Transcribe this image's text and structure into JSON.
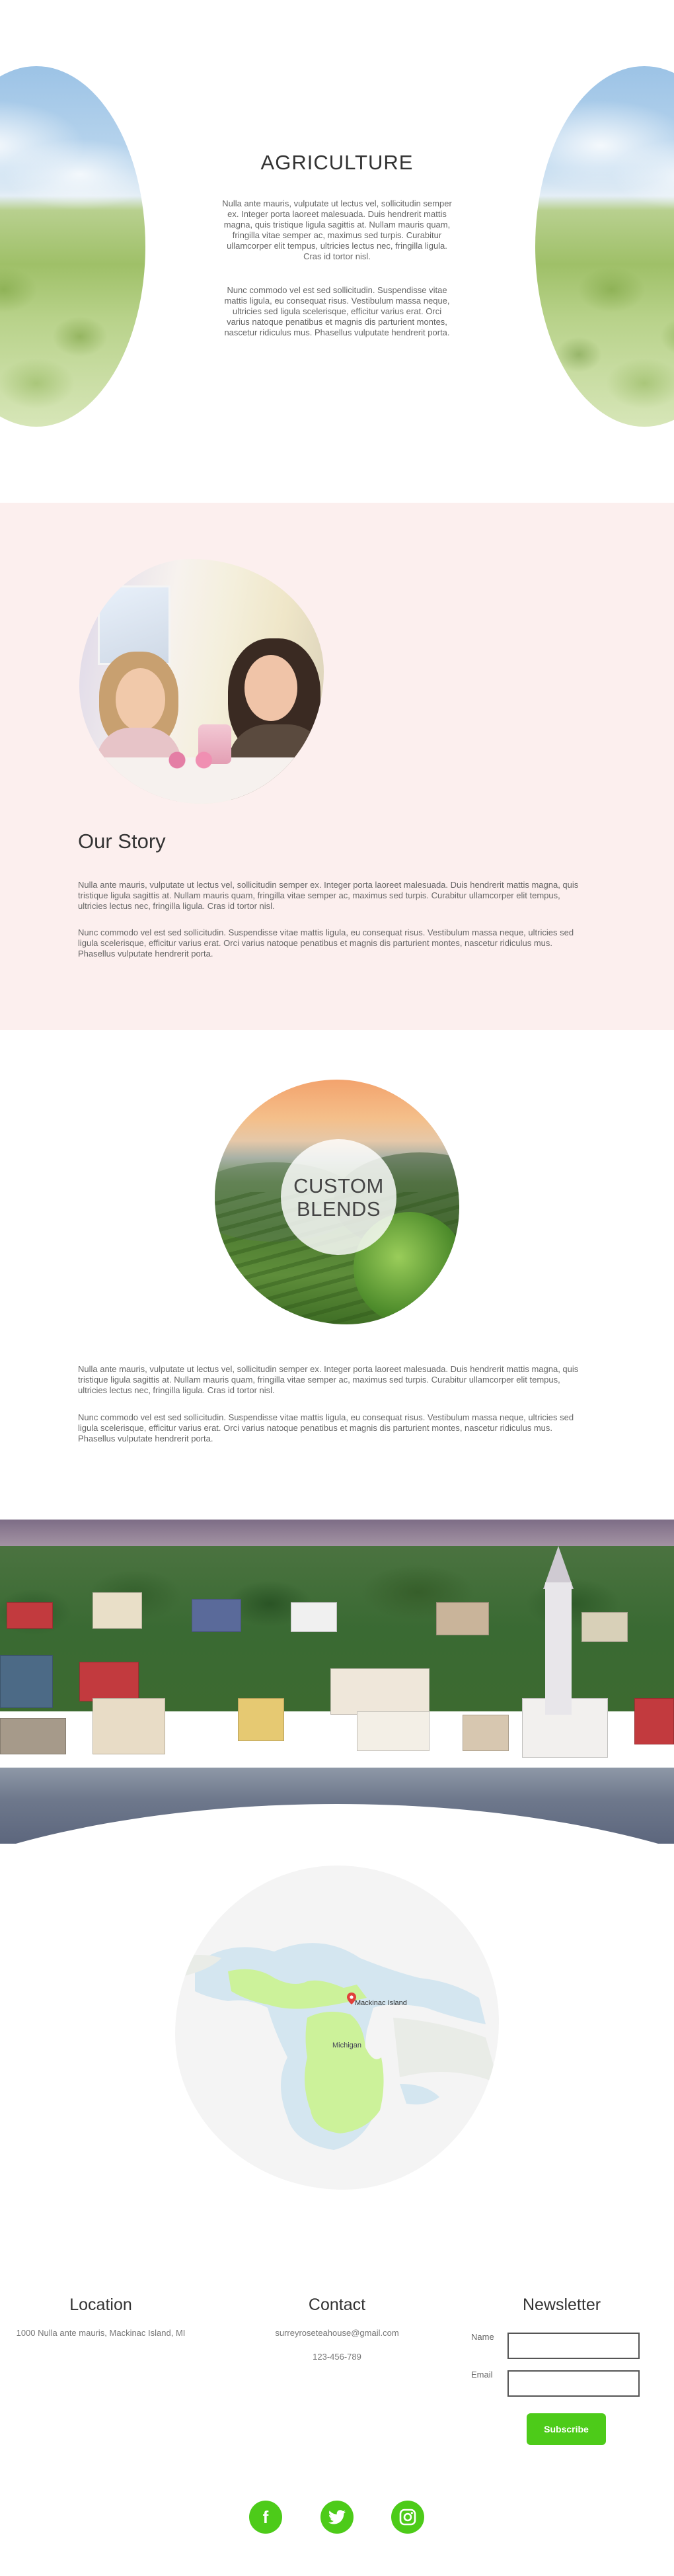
{
  "agriculture": {
    "title": "AGRICULTURE",
    "paragraph1": "Nulla ante mauris, vulputate ut lectus vel, sollicitudin semper ex. Integer porta laoreet malesuada. Duis hendrerit mattis magna, quis tristique ligula sagittis at. Nullam mauris quam, fringilla vitae semper ac, maximus sed turpis. Curabitur ullamcorper elit tempus, ultricies lectus nec, fringilla ligula. Cras id tortor nisl.",
    "paragraph2": "Nunc commodo vel est sed sollicitudin. Suspendisse vitae mattis ligula, eu consequat risus. Vestibulum massa neque, ultricies sed ligula scelerisque, efficitur varius erat. Orci varius natoque penatibus et magnis dis parturient montes, nascetur ridiculus mus. Phasellus vulputate hendrerit porta."
  },
  "story": {
    "title": "Our Story",
    "paragraph1": "Nulla ante mauris, vulputate ut lectus vel, sollicitudin semper ex. Integer porta laoreet malesuada. Duis hendrerit mattis magna, quis tristique ligula sagittis at. Nullam mauris quam, fringilla vitae semper ac, maximus sed turpis. Curabitur ullamcorper elit tempus, ultricies lectus nec, fringilla ligula. Cras id tortor nisl.",
    "paragraph2": "Nunc commodo vel est sed sollicitudin. Suspendisse vitae mattis ligula, eu consequat risus. Vestibulum massa neque, ultricies sed ligula scelerisque, efficitur varius erat. Orci varius natoque penatibus et magnis dis parturient montes, nascetur ridiculus mus. Phasellus vulputate hendrerit porta."
  },
  "blends": {
    "label_line1": "CUSTOM",
    "label_line2": "BLENDS",
    "paragraph1": "Nulla ante mauris, vulputate ut lectus vel, sollicitudin semper ex. Integer porta laoreet malesuada. Duis hendrerit mattis magna, quis tristique ligula sagittis at. Nullam mauris quam, fringilla vitae semper ac, maximus sed turpis. Curabitur ullamcorper elit tempus, ultricies lectus nec, fringilla ligula. Cras id tortor nisl.",
    "paragraph2": "Nunc commodo vel est sed sollicitudin. Suspendisse vitae mattis ligula, eu consequat risus. Vestibulum massa neque, ultricies sed ligula scelerisque, efficitur varius erat. Orci varius natoque penatibus et magnis dis parturient montes, nascetur ridiculus mus. Phasellus vulputate hendrerit porta."
  },
  "map": {
    "pin_label": "Mackinac Island",
    "region_label": "Michigan",
    "pin_icon": "map-pin-icon"
  },
  "footer": {
    "location": {
      "heading": "Location",
      "address": "1000 Nulla ante mauris, Mackinac Island, MI"
    },
    "contact": {
      "heading": "Contact",
      "email": "surreyroseteahouse@gmail.com",
      "phone": "123-456-789"
    },
    "newsletter": {
      "heading": "Newsletter",
      "name_label": "Name",
      "email_label": "Email",
      "name_value": "",
      "email_value": "",
      "subscribe_label": "Subscribe"
    },
    "social": [
      {
        "icon": "facebook-icon",
        "glyph": "f"
      },
      {
        "icon": "twitter-icon",
        "glyph": "🐦"
      },
      {
        "icon": "instagram-icon",
        "glyph": "◎"
      }
    ]
  },
  "colors": {
    "accent": "#4dcb19",
    "story_background": "#fcefee",
    "map_highlight": "#ccf29a",
    "water": "#d4e6f0"
  }
}
